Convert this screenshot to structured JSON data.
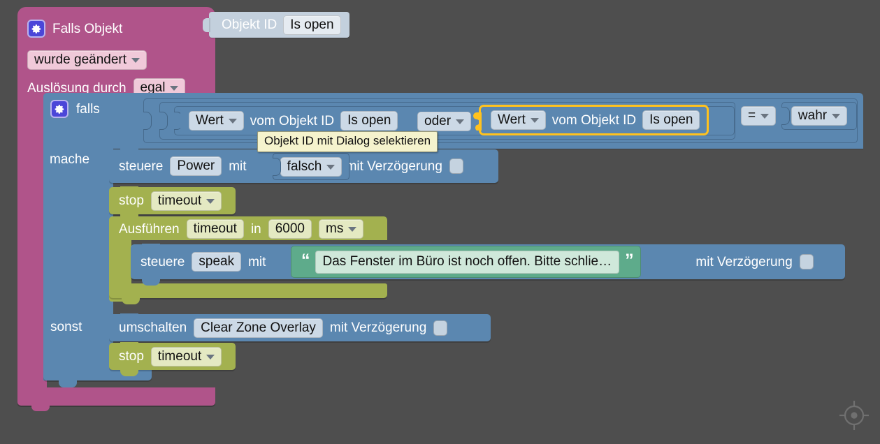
{
  "canvas": {
    "background": "#4e4e4e",
    "editor_name": "blockly-script-canvas"
  },
  "hat_block": {
    "color": "#b0548a",
    "icon": "gear-icon",
    "title": "Falls Objekt",
    "event_field": "wurde geändert",
    "trigger_label": "Auslösung durch",
    "trigger_field": "egal",
    "object_plug": {
      "color": "#c3d0dd",
      "label": "Objekt ID",
      "value": "Is open"
    }
  },
  "if_block": {
    "color": "#5b87b0",
    "icon": "gear-icon",
    "label": "falls",
    "do_label": "mache",
    "else_label": "sonst",
    "condition": {
      "operand_1": {
        "selector": "Wert",
        "text": "vom Objekt ID",
        "object_id": "Is open"
      },
      "operator": "oder",
      "operand_2": {
        "selector": "Wert",
        "text": "vom Objekt ID",
        "object_id": "Is open",
        "selected": true,
        "highlight_color": "#ffc21e"
      },
      "comparator": "=",
      "compare_value": "wahr"
    }
  },
  "tooltip": {
    "text": "Objekt ID mit Dialog selektieren",
    "background": "#f5f3cd"
  },
  "do_branch": {
    "control_power": {
      "color": "#5b87b0",
      "verb": "steuere",
      "target": "Power",
      "with_label": "mit",
      "value": "falsch",
      "delay_label": "mit Verzögerung",
      "delay_checked": false
    },
    "stop_timeout": {
      "color": "#a3b14f",
      "verb": "stop",
      "timer": "timeout"
    },
    "run_timeout": {
      "color": "#a3b14f",
      "verb": "Ausführen",
      "timer": "timeout",
      "in_label": "in",
      "duration": "6000",
      "unit": "ms",
      "body": {
        "color": "#5b87b0",
        "verb": "steuere",
        "target": "speak",
        "with_label": "mit",
        "text_value": "Das Fenster im Büro ist noch offen. Bitte schlie…",
        "text_color": "#5eab8b",
        "delay_label": "mit Verzögerung",
        "delay_checked": false
      }
    }
  },
  "else_branch": {
    "toggle": {
      "color": "#5b87b0",
      "verb": "umschalten",
      "target": "Clear Zone Overlay",
      "delay_label": "mit Verzögerung",
      "delay_checked": false
    },
    "stop_timeout": {
      "color": "#a3b14f",
      "verb": "stop",
      "timer": "timeout"
    }
  },
  "controls": {
    "recenter_icon": "crosshair-recenter-icon"
  }
}
